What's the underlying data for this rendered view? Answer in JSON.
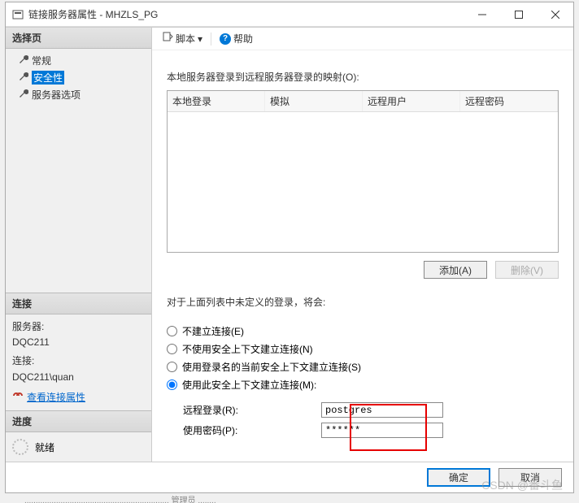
{
  "window": {
    "title": "链接服务器属性 - MHZLS_PG"
  },
  "sidebar": {
    "select_page": "选择页",
    "items": [
      {
        "label": "常规"
      },
      {
        "label": "安全性"
      },
      {
        "label": "服务器选项"
      }
    ],
    "connection": {
      "header": "连接",
      "server_label": "服务器:",
      "server_value": "DQC211",
      "conn_label": "连接:",
      "conn_value": "DQC211\\quan",
      "view_props": "查看连接属性"
    },
    "progress": {
      "header": "进度",
      "status": "就绪"
    }
  },
  "toolbar": {
    "script": "脚本",
    "help": "帮助"
  },
  "main": {
    "mapping_label": "本地服务器登录到远程服务器登录的映射(O):",
    "columns": [
      "本地登录",
      "模拟",
      "远程用户",
      "远程密码"
    ],
    "add_btn": "添加(A)",
    "remove_btn": "删除(V)",
    "undefined_label": "对于上面列表中未定义的登录，将会:",
    "radios": {
      "r1": "不建立连接(E)",
      "r2": "不使用安全上下文建立连接(N)",
      "r3": "使用登录名的当前安全上下文建立连接(S)",
      "r4": "使用此安全上下文建立连接(M):"
    },
    "cred": {
      "remote_login_label": "远程登录(R):",
      "remote_login_value": "postgres",
      "password_label": "使用密码(P):",
      "password_value": "******"
    }
  },
  "footer": {
    "ok": "确定",
    "cancel": "取消"
  },
  "watermark": "CSDN @番斗鱼",
  "garble": "................................................................      管理员    ........"
}
